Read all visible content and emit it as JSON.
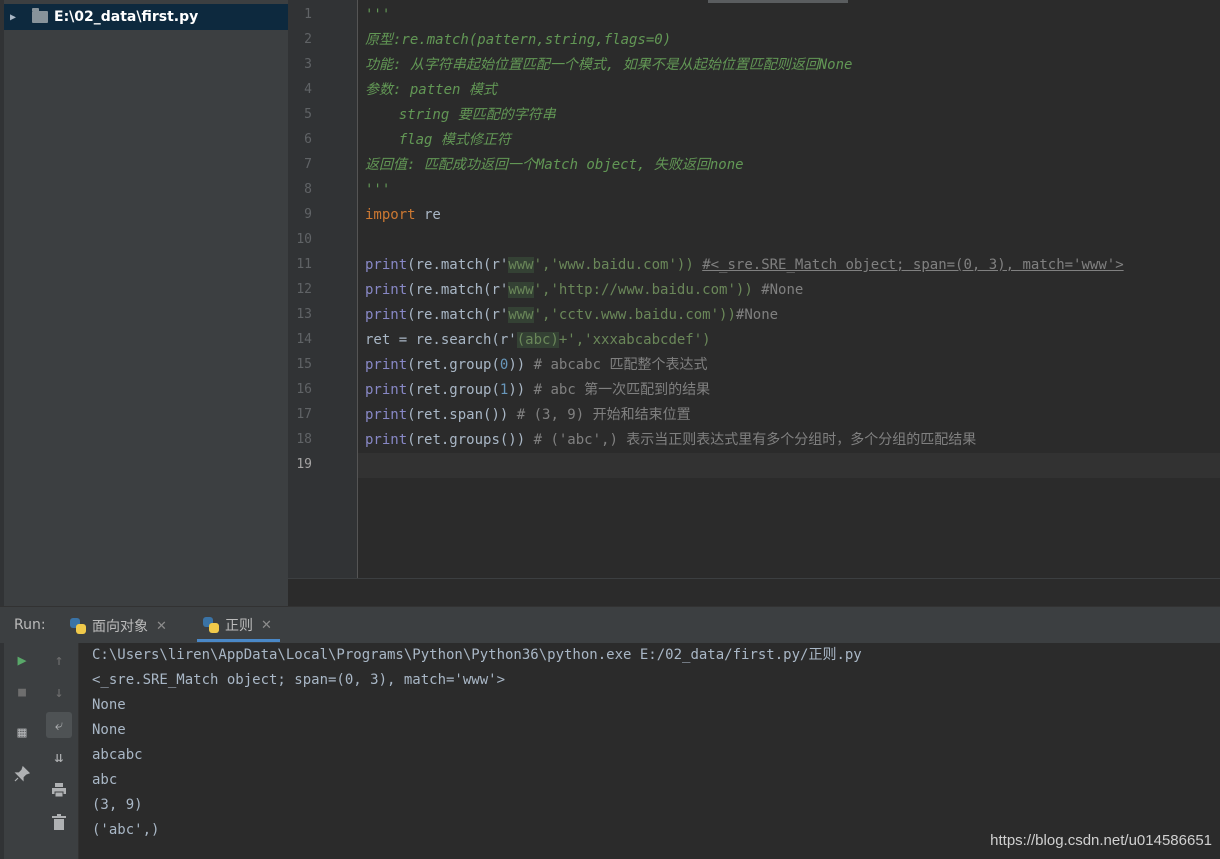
{
  "project": {
    "root_label": "E:\\02_data\\first.py"
  },
  "editor": {
    "line_numbers": [
      "1",
      "2",
      "3",
      "4",
      "5",
      "6",
      "7",
      "8",
      "9",
      "10",
      "11",
      "12",
      "13",
      "14",
      "15",
      "16",
      "17",
      "18",
      "19"
    ],
    "l1": "'''",
    "l2": "原型:re.match(pattern,string,flags=0)",
    "l3": "功能: 从字符串起始位置匹配一个模式, 如果不是从起始位置匹配则返回None",
    "l4": "参数: patten 模式",
    "l5": "    string 要匹配的字符串",
    "l6": "    flag 模式修正符",
    "l7": "返回值: 匹配成功返回一个Match object, 失败返回none",
    "l8": "'''",
    "l9_kw": "import",
    "l9_rest": " re",
    "l11": {
      "fn": "print",
      "a": "(re.match(r'",
      "h": "www",
      "b": "','www.baidu.com')) ",
      "c": "#<_sre.SRE_Match object; span=(0, 3), match='www'>"
    },
    "l12": {
      "fn": "print",
      "a": "(re.match(r'",
      "h": "www",
      "b": "','http://www.baidu.com')) ",
      "c": "#None"
    },
    "l13": {
      "fn": "print",
      "a": "(re.match(r'",
      "h": "www",
      "b": "','cctv.www.baidu.com'))",
      "c": "#None"
    },
    "l14": {
      "a": "ret = re.search(r'",
      "h": "(abc)",
      "b": "+','xxxabcabcdef')"
    },
    "l15": {
      "fn": "print",
      "a": "(ret.group(",
      "n": "0",
      "b": ")) ",
      "c": "# abcabc 匹配整个表达式"
    },
    "l16": {
      "fn": "print",
      "a": "(ret.group(",
      "n": "1",
      "b": ")) ",
      "c": "# abc 第一次匹配到的结果"
    },
    "l17": {
      "fn": "print",
      "a": "(ret.span()) ",
      "c": "# (3, 9) 开始和结束位置"
    },
    "l18": {
      "fn": "print",
      "a": "(ret.groups()) ",
      "c": "# ('abc',) 表示当正则表达式里有多个分组时，多个分组的匹配结果"
    }
  },
  "run": {
    "label": "Run:",
    "tabs": [
      {
        "label": "面向对象"
      },
      {
        "label": "正则"
      }
    ],
    "output": [
      "C:\\Users\\liren\\AppData\\Local\\Programs\\Python\\Python36\\python.exe E:/02_data/first.py/正则.py",
      "<_sre.SRE_Match object; span=(0, 3), match='www'>",
      "None",
      "None",
      "abcabc",
      "abc",
      "(3, 9)",
      "('abc',)"
    ]
  },
  "watermark": "https://blog.csdn.net/u014586651",
  "icons": {
    "expand": "▶",
    "close": "✕",
    "play": "▶",
    "stop": "■",
    "up": "↑",
    "down": "↓",
    "layout": "▦",
    "wrap": "⤶",
    "scroll_end": "⇊",
    "print": "⎙",
    "pin": "📌",
    "trash": "🗑"
  }
}
